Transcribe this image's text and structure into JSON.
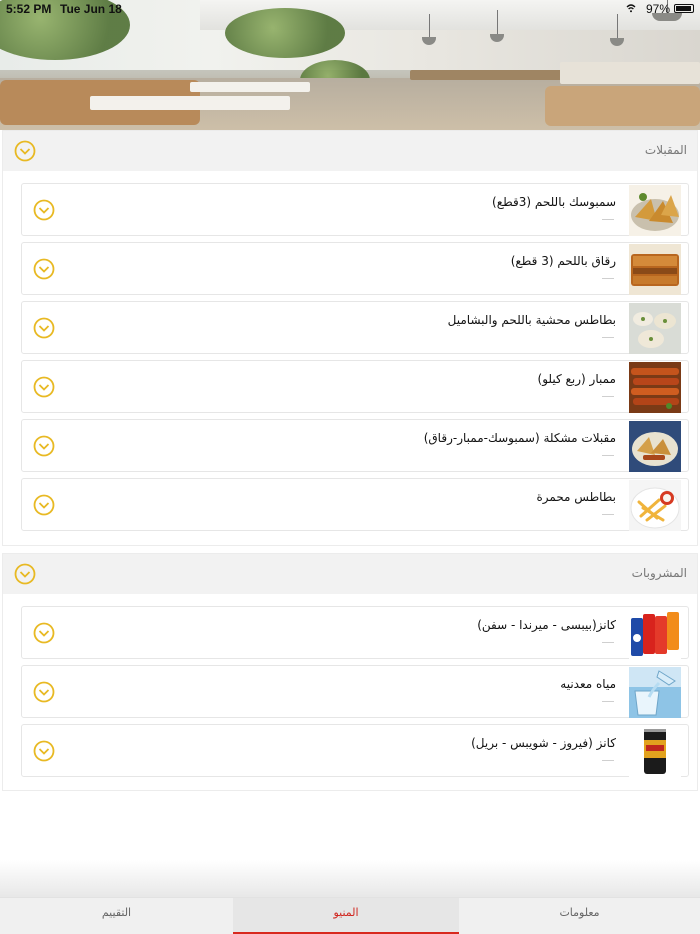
{
  "status_bar": {
    "time": "5:52 PM",
    "date": "Tue Jun 18",
    "battery": "97%"
  },
  "sections": [
    {
      "title": "المقبلات",
      "items": [
        {
          "name": "سمبوسك باللحم (3قطع)",
          "thumb": "samosa-image"
        },
        {
          "name": "رقاق باللحم (3 قطع)",
          "thumb": "pastry-image"
        },
        {
          "name": "بطاطس محشية باللحم والبشاميل",
          "thumb": "stuffed-potato-image"
        },
        {
          "name": "ممبار (ربع كيلو)",
          "thumb": "mumbar-image"
        },
        {
          "name": "مقبلات مشكلة (سمبوسك-ممبار-رقاق)",
          "thumb": "mixed-appetizers-image"
        },
        {
          "name": "بطاطس محمرة",
          "thumb": "fries-image"
        }
      ]
    },
    {
      "title": "المشروبات",
      "items": [
        {
          "name": "كانز(بيبسى - ميرندا - سفن)",
          "thumb": "soda-cans-image"
        },
        {
          "name": "مياه معدنيه",
          "thumb": "water-image"
        },
        {
          "name": "كانز (فيروز - شويبس - بريل)",
          "thumb": "birell-can-image"
        }
      ]
    }
  ],
  "tabs": [
    {
      "label": "التقييم"
    },
    {
      "label": "المنيو"
    },
    {
      "label": "معلومات"
    }
  ],
  "colors": {
    "accent": "#f1c40f",
    "active_tab": "#d8291e"
  }
}
